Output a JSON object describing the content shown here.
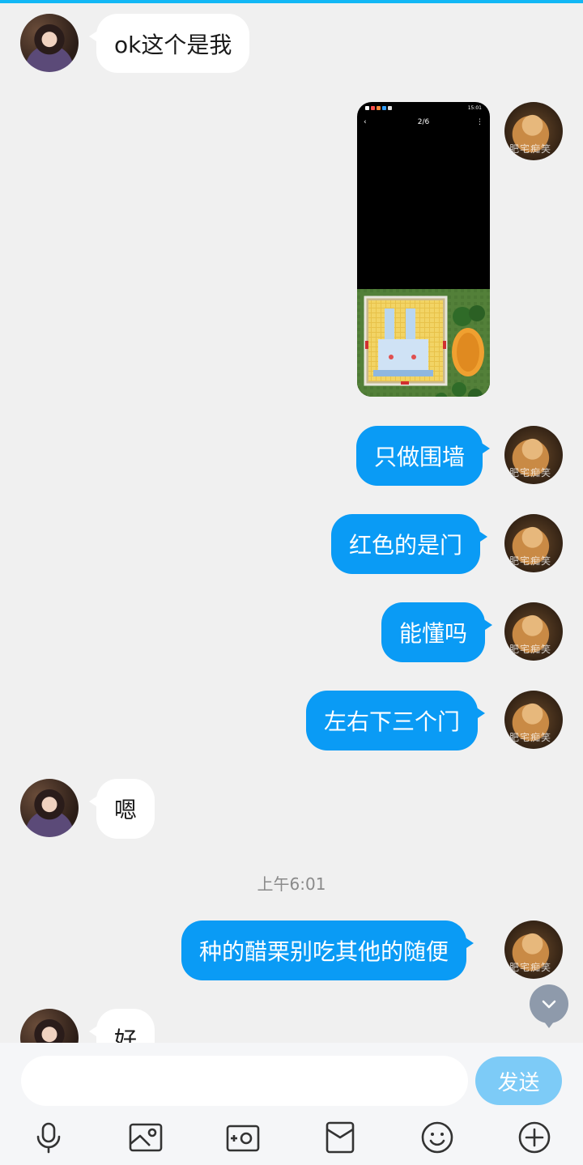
{
  "conversation": {
    "messages": [
      {
        "side": "left",
        "text": "ok这个是我"
      },
      {
        "side": "right",
        "type": "image"
      },
      {
        "side": "right",
        "text": "只做围墙"
      },
      {
        "side": "right",
        "text": "红色的是门"
      },
      {
        "side": "right",
        "text": "能懂吗"
      },
      {
        "side": "right",
        "text": "左右下三个门"
      },
      {
        "side": "left",
        "text": "嗯"
      },
      {
        "side": "right",
        "text": "种的醋栗别吃其他的随便"
      },
      {
        "side": "left",
        "text": "好"
      }
    ],
    "timestamp": "上午6:01"
  },
  "image_message": {
    "status_time": "15:01",
    "pager": "2/6",
    "back_icon": "chevron-left-icon",
    "more_icon": "more-vertical-icon"
  },
  "avatar_watermark": "肥宅痴笑",
  "composer": {
    "input_value": "",
    "input_placeholder": "",
    "send_label": "发送"
  },
  "toolbar": {
    "icons": [
      "microphone-icon",
      "image-icon",
      "camera-icon",
      "red-envelope-icon",
      "emoji-icon",
      "plus-icon"
    ]
  },
  "colors": {
    "accent": "#12b7f5",
    "outgoing_bubble": "#0a9bf5",
    "incoming_bubble": "#ffffff",
    "send_button": "#7dcbf7",
    "background": "#f0f0f0"
  }
}
